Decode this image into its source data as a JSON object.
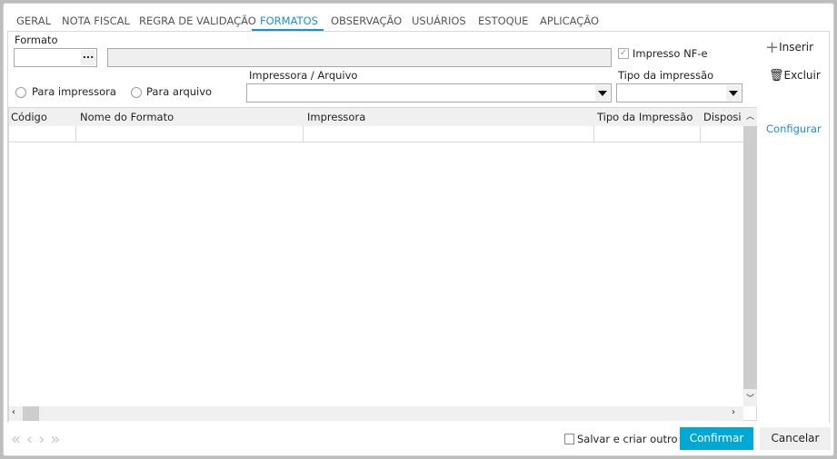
{
  "tabs": [
    "GERAL",
    "NOTA FISCAL",
    "REGRA DE VALIDAÇÃO",
    "FORMATOS",
    "OBSERVAÇÃO",
    "USUÁRIOS",
    "ESTOQUE",
    "APLICAÇÃO"
  ],
  "active_tab": "FORMATOS",
  "form": {
    "formato_label": "Formato",
    "formato_value": "",
    "formato_desc": "",
    "browse_label": "...",
    "impresso_nfe_label": "Impresso NF-e",
    "impresso_nfe_checked": true,
    "radio_impressora": "Para impressora",
    "radio_arquivo": "Para arquivo",
    "impressora_label": "Impressora / Arquivo",
    "impressora_value": "",
    "tipo_label": "Tipo da impressão",
    "tipo_value": ""
  },
  "actions": {
    "inserir": "Inserir",
    "excluir": "Excluir",
    "configurar": "Configurar"
  },
  "grid": {
    "columns": [
      "Código",
      "Nome do Formato",
      "Impressora",
      "Tipo da Impressão",
      "Disposi"
    ],
    "rows": []
  },
  "footer": {
    "salvar_label": "Salvar e criar outro",
    "salvar_checked": false,
    "confirmar": "Confirmar",
    "cancelar": "Cancelar"
  },
  "colors": {
    "accent": "#1a8fd6",
    "confirm": "#00a8d6"
  }
}
